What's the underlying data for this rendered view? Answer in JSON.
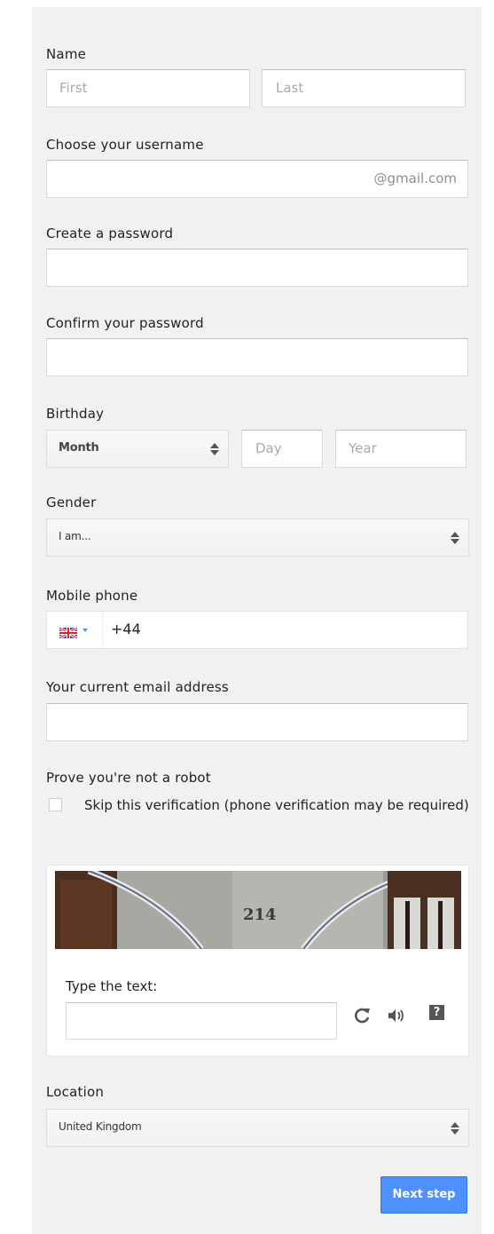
{
  "name": {
    "label": "Name",
    "first_placeholder": "First",
    "last_placeholder": "Last"
  },
  "username": {
    "label": "Choose your username",
    "suffix": "@gmail.com"
  },
  "password": {
    "label": "Create a password"
  },
  "confirm_password": {
    "label": "Confirm your password"
  },
  "birthday": {
    "label": "Birthday",
    "month_value": "Month",
    "day_placeholder": "Day",
    "year_placeholder": "Year"
  },
  "gender": {
    "label": "Gender",
    "value": "I am..."
  },
  "mobile": {
    "label": "Mobile phone",
    "country_flag": "uk-flag-icon",
    "prefix": "+44"
  },
  "current_email": {
    "label": "Your current email address"
  },
  "robot": {
    "label": "Prove you're not a robot",
    "skip_text": "Skip this verification (phone verification may be required)",
    "skip_checked": false,
    "captcha_image_text": "214",
    "type_text_label": "Type the text:",
    "icons": [
      "refresh-icon",
      "audio-icon",
      "help-icon"
    ]
  },
  "location": {
    "label": "Location",
    "value": "United Kingdom"
  },
  "next_button": "Next step",
  "colors": {
    "accent": "#4d90fe",
    "panel": "#f1f1f1"
  }
}
